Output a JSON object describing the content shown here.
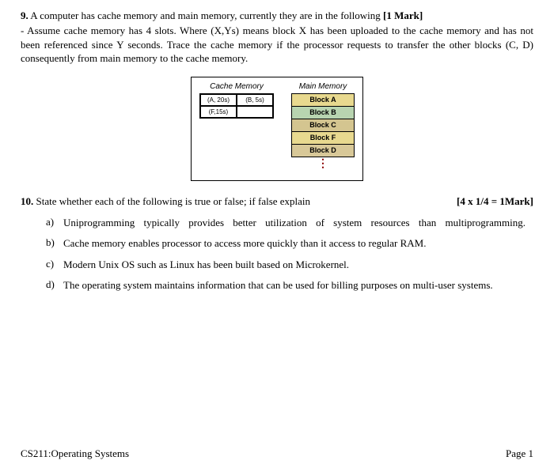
{
  "q9": {
    "number": "9.",
    "intro": "A computer has cache memory and main memory, currently they are in the following",
    "mark": "[1 Mark]",
    "body": "- Assume cache memory has 4 slots. Where (X,Ys) means block X has been uploaded to the cache memory and has not been referenced since Y seconds. Trace the cache memory if the processor requests to transfer the other blocks (C, D) consequently from main memory to the cache memory."
  },
  "diagram": {
    "cache_title": "Cache Memory",
    "main_title": "Main Memory",
    "cache_slots": [
      [
        "(A, 20s)",
        "(B, 5s)"
      ],
      [
        "(F,15s)",
        ""
      ]
    ],
    "main_blocks": [
      {
        "label": "Block A",
        "class": "block-a"
      },
      {
        "label": "Block B",
        "class": "block-b"
      },
      {
        "label": "Block C",
        "class": "block-c"
      },
      {
        "label": "Block F",
        "class": "block-f"
      },
      {
        "label": "Block D",
        "class": "block-d"
      }
    ],
    "dots": "⋮"
  },
  "q10": {
    "number": "10.",
    "intro": "State whether each of the following is true or false; if false explain",
    "mark": "[4 x 1/4 = 1Mark]",
    "options": [
      {
        "letter": "a)",
        "text": "Uniprogramming typically provides better utilization of system resources than multiprogramming.",
        "spaced": true
      },
      {
        "letter": "b)",
        "text": "Cache memory enables processor to access more quickly than it access to regular RAM.",
        "spaced": false
      },
      {
        "letter": "c)",
        "text": "Modern Unix OS such as Linux has been built based on Microkernel.",
        "spaced": false
      },
      {
        "letter": "d)",
        "text": "The operating system maintains information that can be used for billing purposes on multi-user systems.",
        "spaced": false
      }
    ]
  },
  "footer": {
    "course": "CS211:Operating Systems",
    "page": "Page 1"
  }
}
